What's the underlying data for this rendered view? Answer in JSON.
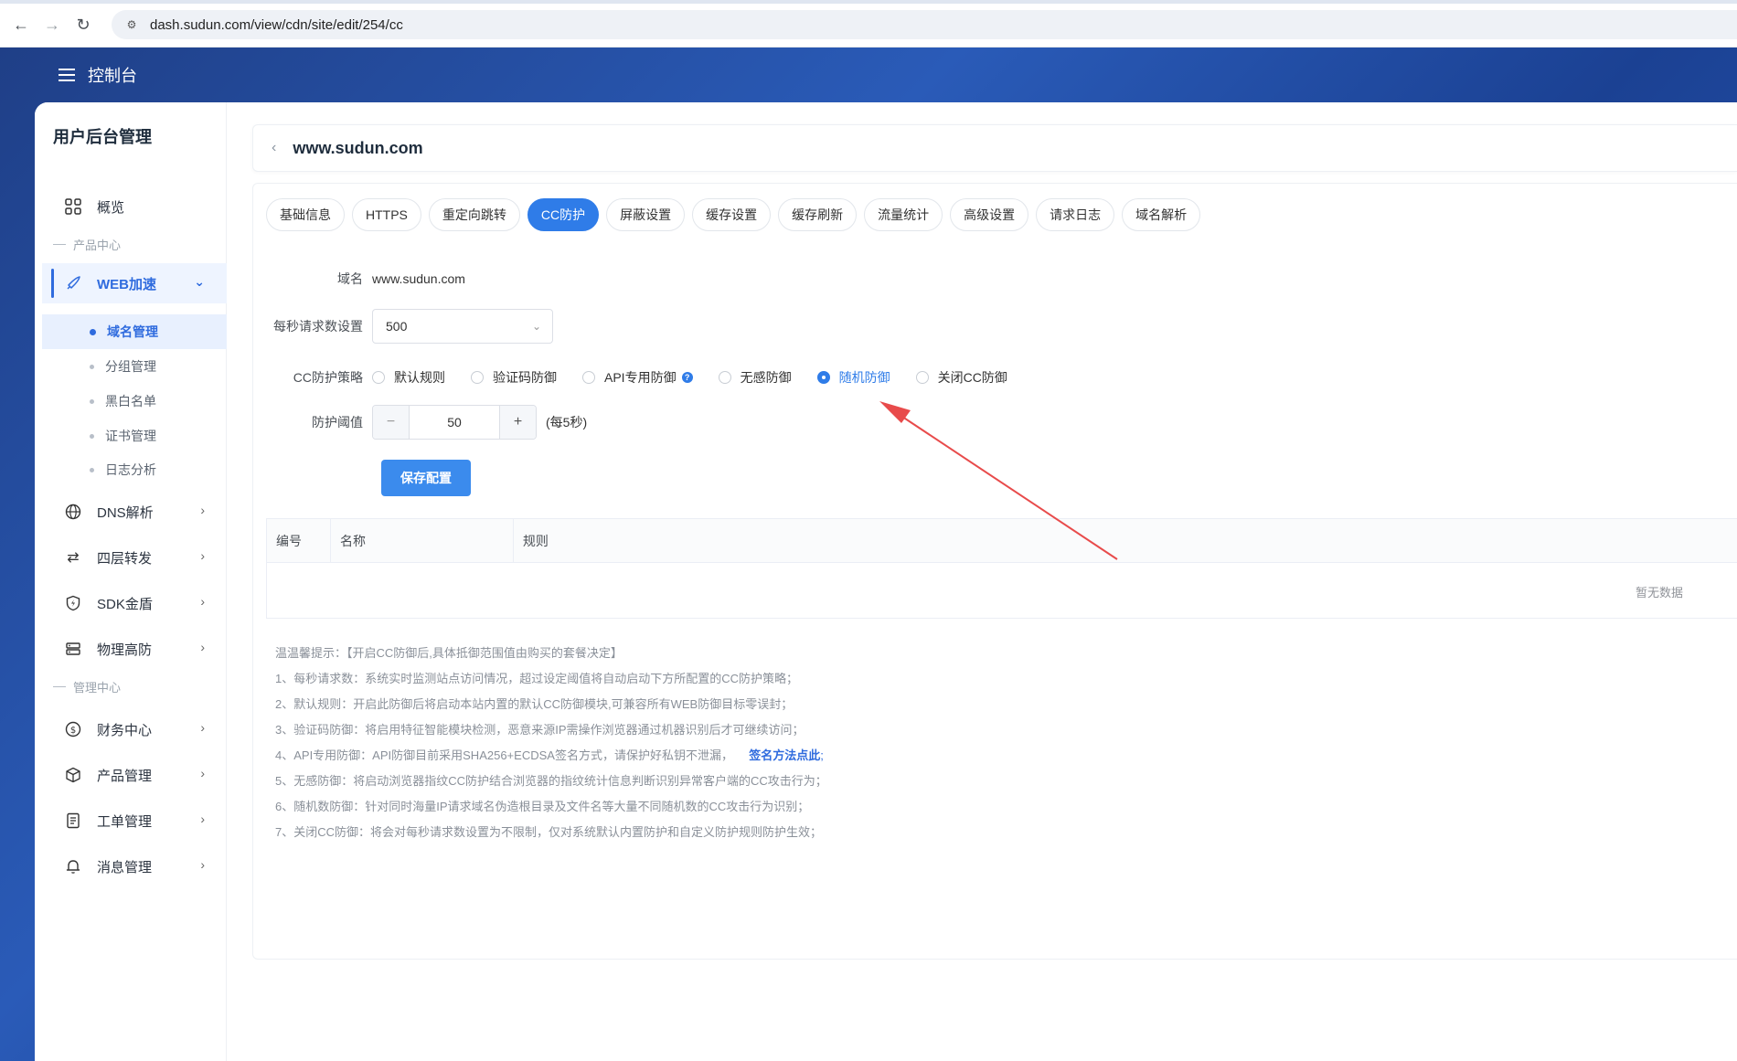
{
  "browser": {
    "url": "dash.sudun.com/view/cdn/site/edit/254/cc"
  },
  "header": {
    "title": "控制台"
  },
  "sidebar": {
    "title": "用户后台管理",
    "overview": "概览",
    "section_product": "产品中心",
    "web_accel": "WEB加速",
    "sub_items": [
      "域名管理",
      "分组管理",
      "黑白名单",
      "证书管理",
      "日志分析"
    ],
    "dns": "DNS解析",
    "l4": "四层转发",
    "sdk": "SDK金盾",
    "physical": "物理高防",
    "section_manage": "管理中心",
    "finance": "财务中心",
    "product_mgmt": "产品管理",
    "ticket": "工单管理",
    "message": "消息管理"
  },
  "domain_card": {
    "domain": "www.sudun.com"
  },
  "tabs": [
    "基础信息",
    "HTTPS",
    "重定向跳转",
    "CC防护",
    "屏蔽设置",
    "缓存设置",
    "缓存刷新",
    "流量统计",
    "高级设置",
    "请求日志",
    "域名解析"
  ],
  "active_tab": "CC防护",
  "form": {
    "domain_label": "域名",
    "domain_value": "www.sudun.com",
    "rps_label": "每秒请求数设置",
    "rps_value": "500",
    "policy_label": "CC防护策略",
    "policies": [
      "默认规则",
      "验证码防御",
      "API专用防御",
      "无感防御",
      "随机防御",
      "关闭CC防御"
    ],
    "selected_policy": "随机防御",
    "threshold_label": "防护阈值",
    "threshold_value": "50",
    "threshold_unit": "(每5秒)",
    "save_label": "保存配置"
  },
  "table": {
    "headers": [
      "编号",
      "名称",
      "规则"
    ],
    "empty_text": "暂无数据"
  },
  "tips": {
    "intro": "温温馨提示：【开启CC防御后,具体抵御范围值由购买的套餐决定】",
    "lines": [
      "1、每秒请求数：系统实时监测站点访问情况，超过设定阈值将自动启动下方所配置的CC防护策略；",
      "2、默认规则：开启此防御后将启动本站内置的默认CC防御模块,可兼容所有WEB防御目标零误封；",
      "3、验证码防御：将启用特征智能模块检测，恶意来源IP需操作浏览器通过机器识别后才可继续访问；",
      "4、API专用防御：API防御目前采用SHA256+ECDSA签名方式，请保护好私钥不泄漏，",
      "5、无感防御：将启动浏览器指纹CC防护结合浏览器的指纹统计信息判断识别异常客户端的CC攻击行为；",
      "6、随机数防御：针对同时海量IP请求域名伪造根目录及文件名等大量不同随机数的CC攻击行为识别；",
      "7、关闭CC防御：将会对每秒请求数设置为不限制，仅对系统默认内置防护和自定义防护规则防护生效；"
    ],
    "link_text": "签名方法点此",
    "link_suffix": ";"
  },
  "colors": {
    "primary": "#2f7ce8",
    "arrow": "#e84b4b"
  }
}
